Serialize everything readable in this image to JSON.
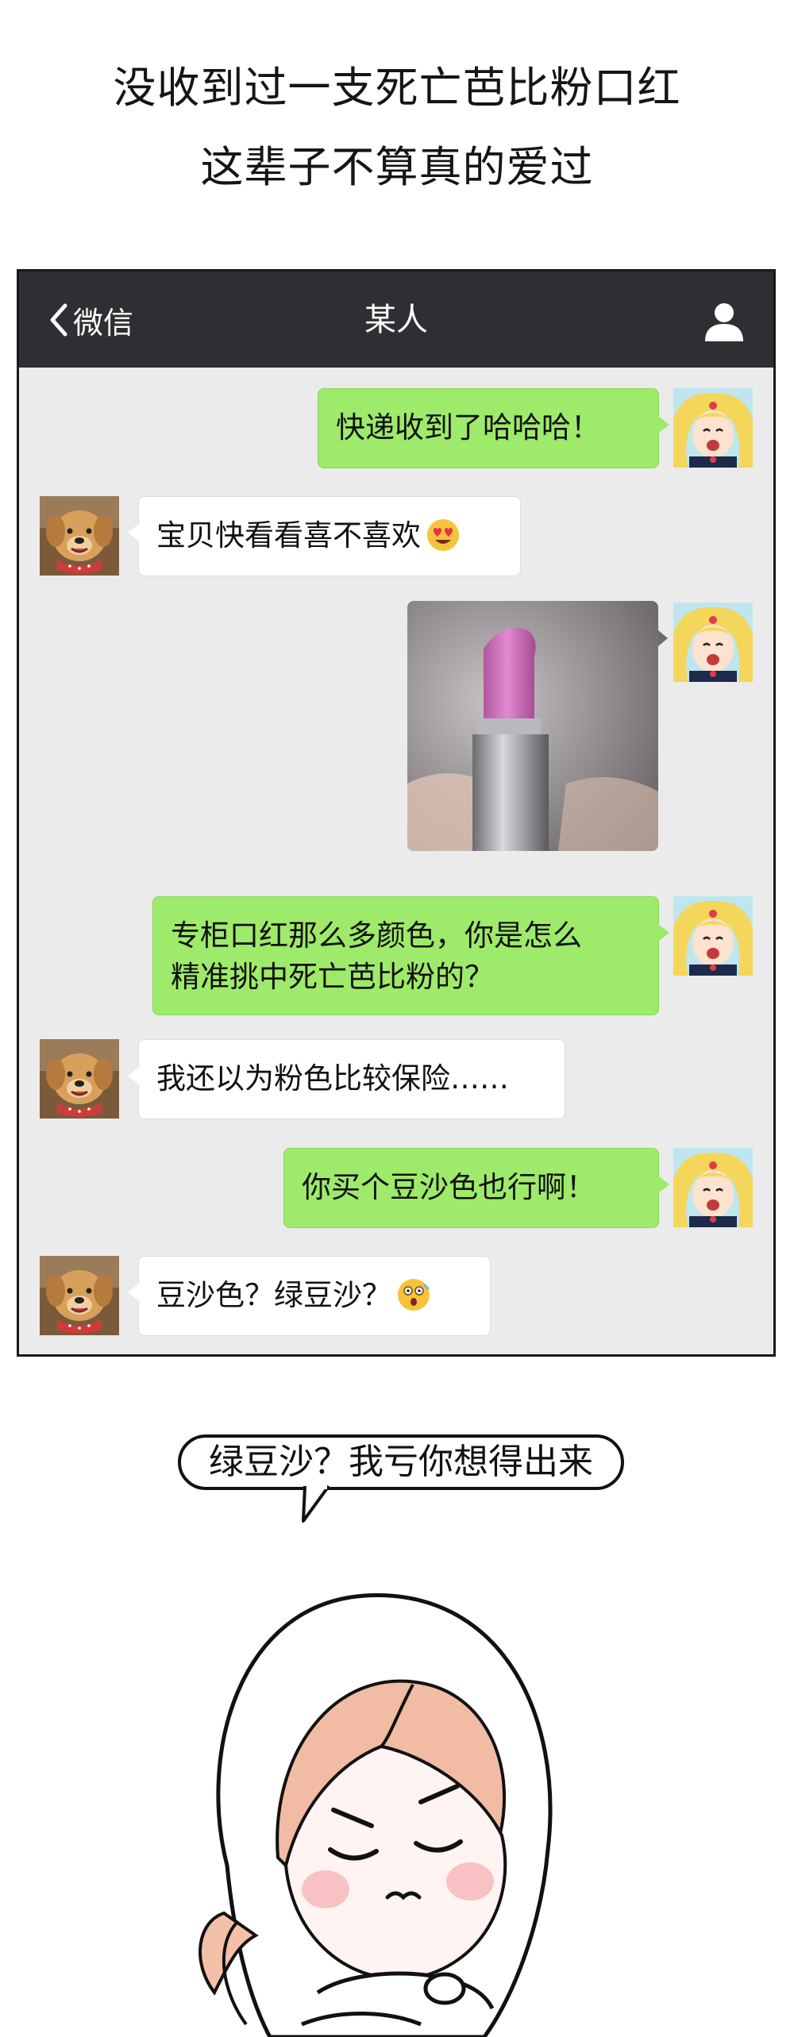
{
  "headline": {
    "line1": "没收到过一支死亡芭比粉口红",
    "line2": "这辈子不算真的爱过"
  },
  "navbar": {
    "back_label": "微信",
    "title": "某人",
    "back_icon": "chevron-left-icon",
    "user_icon": "person-icon"
  },
  "messages": [
    {
      "from": "me",
      "type": "text",
      "text": "快递收到了哈哈哈！"
    },
    {
      "from": "them",
      "type": "text",
      "text": "宝贝快看看喜不喜欢",
      "emoji": "heart-eyes-emoji"
    },
    {
      "from": "me",
      "type": "image",
      "image": "pink-lipstick-photo"
    },
    {
      "from": "me",
      "type": "text",
      "lines": [
        "专柜口红那么多颜色，你是怎么",
        "精准挑中死亡芭比粉的？"
      ]
    },
    {
      "from": "them",
      "type": "text",
      "text": "我还以为粉色比较保险……"
    },
    {
      "from": "me",
      "type": "text",
      "text": "你买个豆沙色也行啊！"
    },
    {
      "from": "them",
      "type": "text",
      "text": "豆沙色？绿豆沙？",
      "emoji": "shocked-emoji"
    }
  ],
  "comic": {
    "speech": "绿豆沙？我亏你想得出来",
    "character": "hooded-girl-arms-crossed"
  },
  "colors": {
    "navbar": "#2f2f33",
    "chat_bg": "#ebebeb",
    "outgoing_bubble": "#9eea6a",
    "incoming_bubble": "#ffffff"
  }
}
